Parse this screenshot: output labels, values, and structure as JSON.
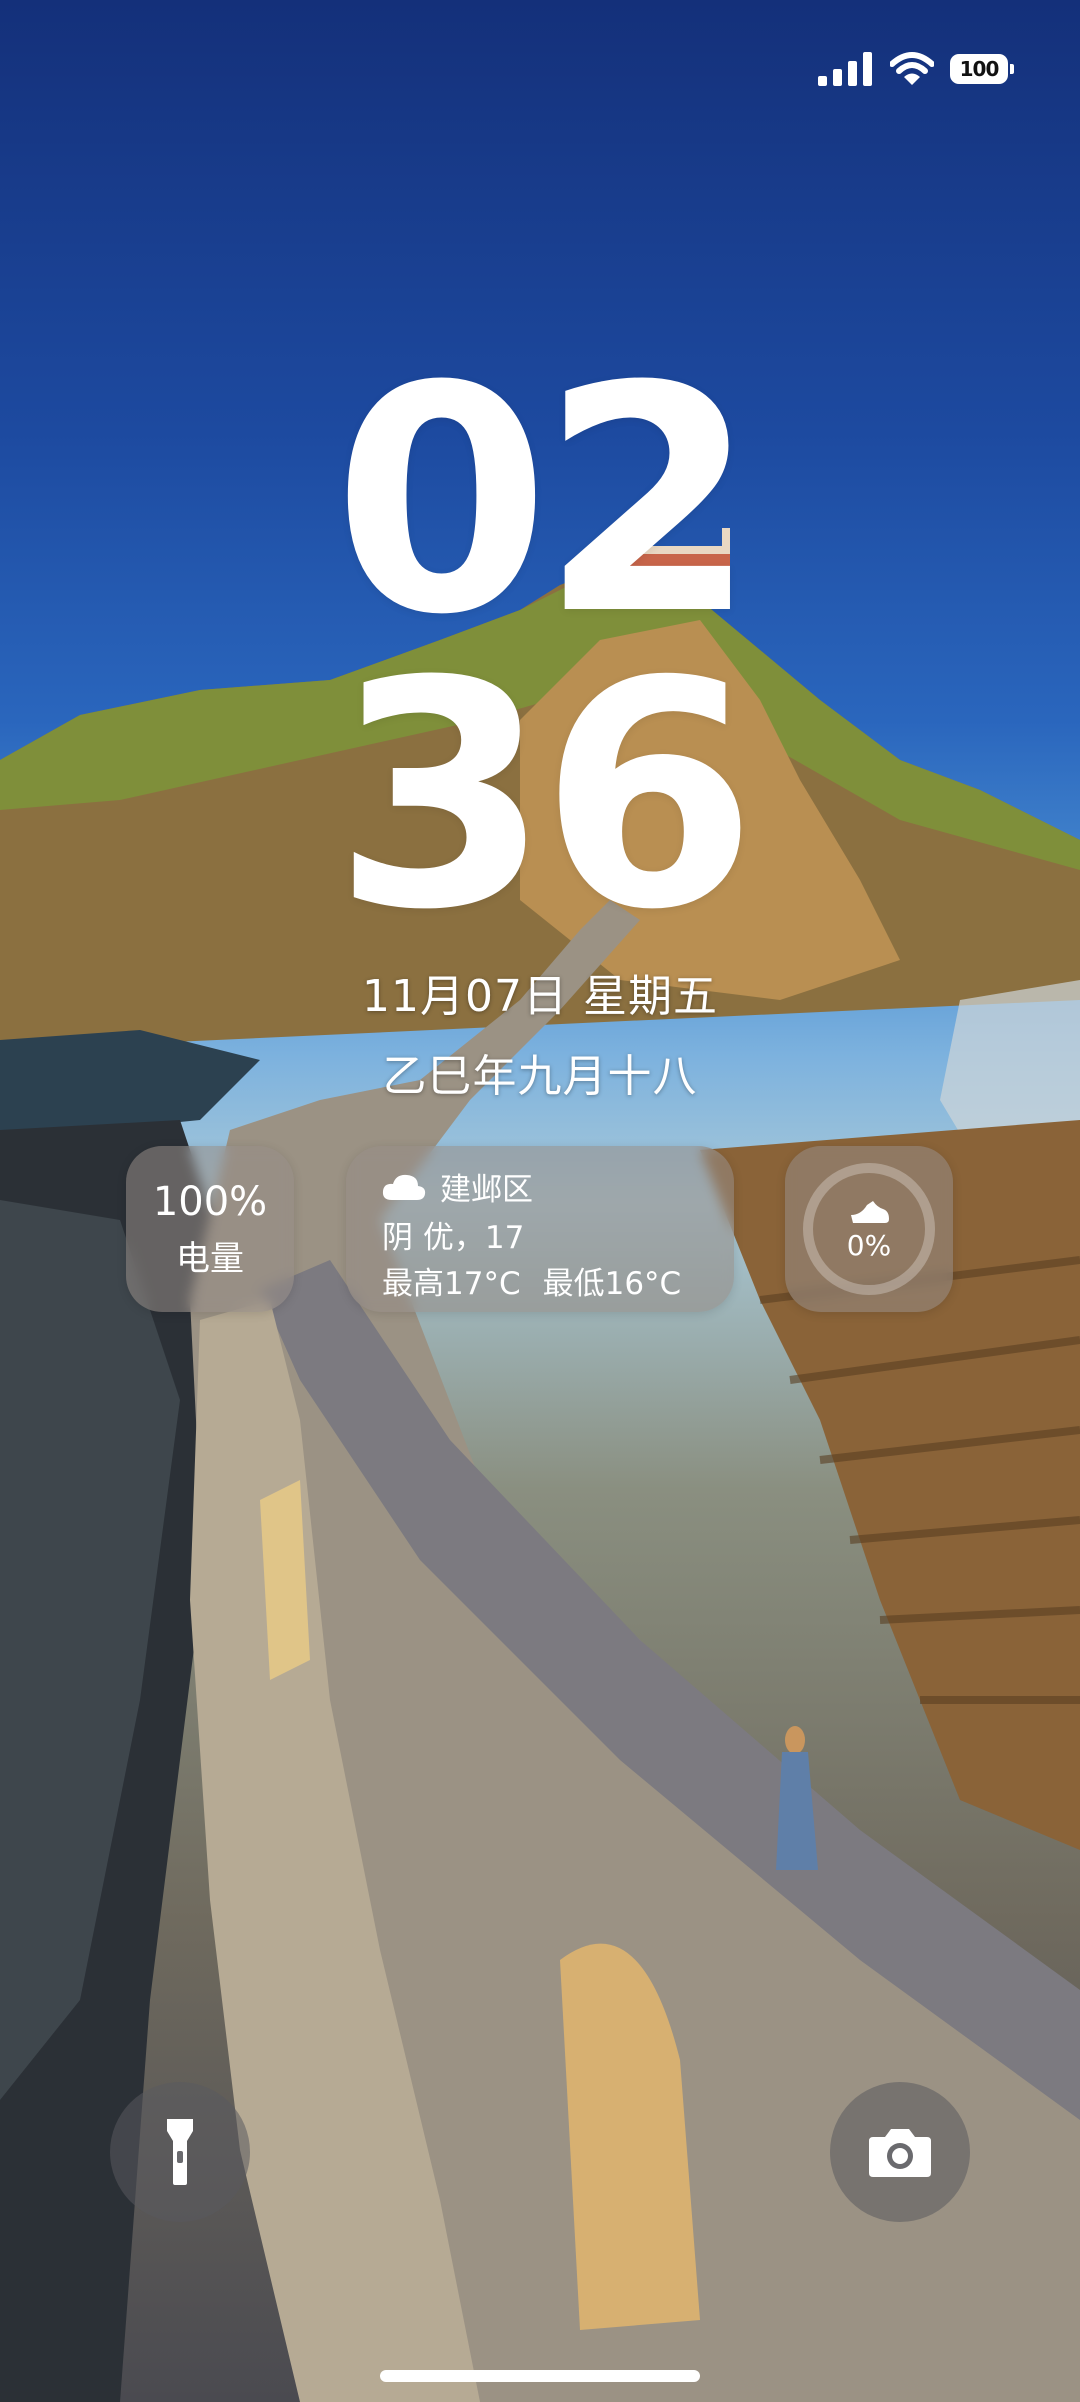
{
  "status_bar": {
    "battery_level": "100",
    "icons": [
      "signal-icon",
      "wifi-icon",
      "battery-icon"
    ]
  },
  "clock": {
    "hours": "02",
    "minutes": "36"
  },
  "date": {
    "solar": "11月07日 星期五",
    "lunar": "乙巳年九月十八"
  },
  "widgets": {
    "battery": {
      "value": "100%",
      "label": "电量"
    },
    "weather": {
      "location": "建邺区",
      "condition": "阴 优，17",
      "high": "最高17°C",
      "low": "最低16°C",
      "icon": "cloud-icon"
    },
    "steps": {
      "value": "0%",
      "icon": "shoe-icon"
    }
  },
  "quick_actions": {
    "left_icon": "flashlight-icon",
    "right_icon": "camera-icon"
  }
}
